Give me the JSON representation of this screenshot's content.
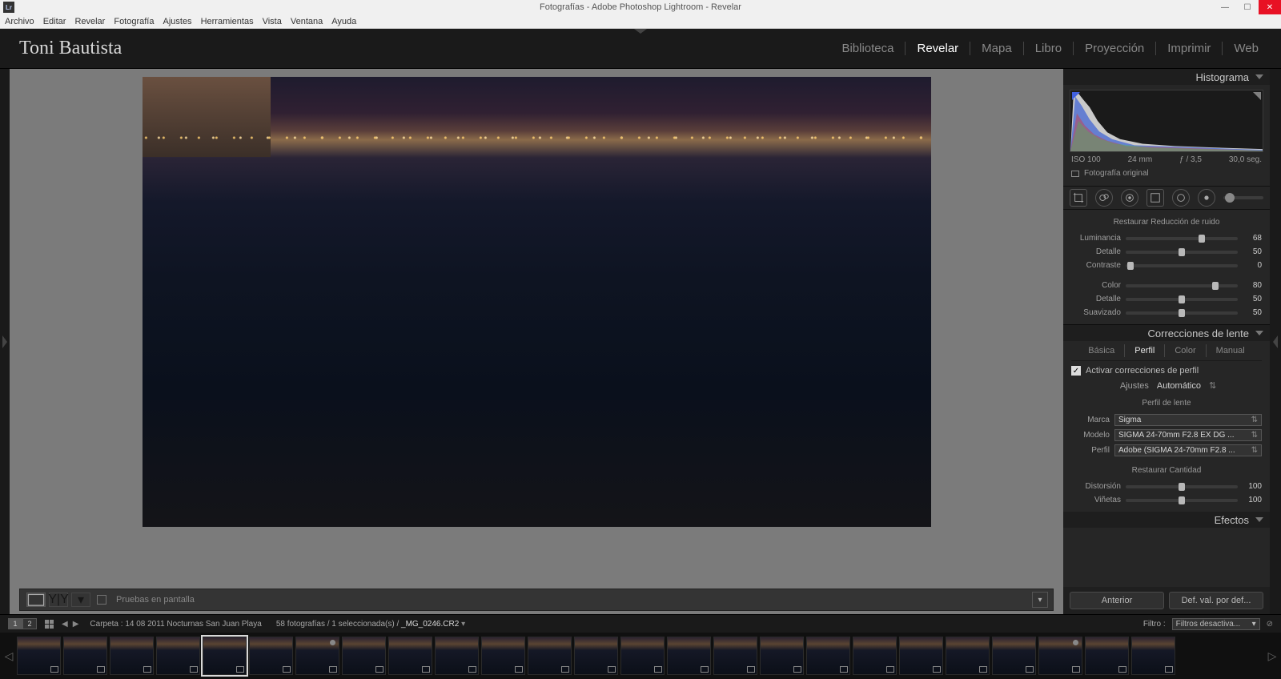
{
  "window": {
    "app_badge": "Lr",
    "title": "Fotografías - Adobe Photoshop Lightroom - Revelar",
    "min": "—",
    "max": "☐",
    "close": "✕"
  },
  "menu": [
    "Archivo",
    "Editar",
    "Revelar",
    "Fotografía",
    "Ajustes",
    "Herramientas",
    "Vista",
    "Ventana",
    "Ayuda"
  ],
  "header": {
    "brand": "Toni Bautista",
    "modules": [
      "Biblioteca",
      "Revelar",
      "Mapa",
      "Libro",
      "Proyección",
      "Imprimir",
      "Web"
    ],
    "active_module": "Revelar"
  },
  "center": {
    "soft_proof_label": "Pruebas en pantalla"
  },
  "histogram": {
    "title": "Histograma",
    "iso": "ISO 100",
    "focal": "24 mm",
    "aperture": "ƒ / 3,5",
    "shutter": "30,0 seg.",
    "original_label": "Fotografía original"
  },
  "noise": {
    "title": "Restaurar Reducción de ruido",
    "sliders1": [
      {
        "label": "Luminancia",
        "value": 68,
        "pct": 68
      },
      {
        "label": "Detalle",
        "value": 50,
        "pct": 50
      },
      {
        "label": "Contraste",
        "value": 0,
        "pct": 4
      }
    ],
    "sliders2": [
      {
        "label": "Color",
        "value": 80,
        "pct": 80
      },
      {
        "label": "Detalle",
        "value": 50,
        "pct": 50
      },
      {
        "label": "Suavizado",
        "value": 50,
        "pct": 50
      }
    ]
  },
  "lens": {
    "title": "Correcciones de lente",
    "tabs": [
      "Básica",
      "Perfil",
      "Color",
      "Manual"
    ],
    "active_tab": "Perfil",
    "enable_label": "Activar correcciones de perfil",
    "adjust_label": "Ajustes",
    "adjust_value": "Automático",
    "profile_heading": "Perfil de lente",
    "brand_label": "Marca",
    "brand_value": "Sigma",
    "model_label": "Modelo",
    "model_value": "SIGMA 24-70mm F2.8 EX DG ...",
    "profile_label": "Perfil",
    "profile_value": "Adobe (SIGMA 24-70mm F2.8 ...",
    "amount_heading": "Restaurar Cantidad",
    "amount_sliders": [
      {
        "label": "Distorsión",
        "value": 100,
        "pct": 50
      },
      {
        "label": "Viñetas",
        "value": 100,
        "pct": 50
      }
    ]
  },
  "effects": {
    "title": "Efectos"
  },
  "buttons": {
    "prev": "Anterior",
    "reset": "Def. val. por def..."
  },
  "strip": {
    "folder_lbl": "Carpeta : 14 08 2011 Nocturnas San Juan Playa",
    "count_lbl": "58 fotografías / 1 seleccionada(s) /",
    "filename": "_MG_0246.CR2",
    "filter_label": "Filtro :",
    "filter_value": "Filtros desactiva...",
    "monitor_tabs": [
      "1",
      "2"
    ],
    "selected_index": 4,
    "thumb_count": 25
  }
}
